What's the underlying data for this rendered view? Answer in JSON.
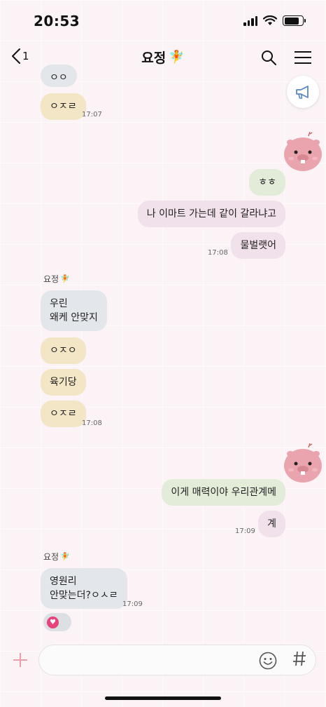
{
  "status_bar": {
    "time": "20:53"
  },
  "header": {
    "back_count": "1",
    "title": "요정",
    "title_emoji": "🧚"
  },
  "partial_message": {
    "text": "ㅇㅇ"
  },
  "messages": [
    {
      "text": "ㅇㅈㄹ",
      "time": "17:07"
    },
    {
      "text": "ㅎㅎ"
    },
    {
      "text": "나 이마트 가는데 같이 갈라냐고"
    },
    {
      "text": "물벌랫어",
      "time": "17:08"
    },
    {
      "sender": "요정",
      "lines": [
        "우린",
        "왜케 안맞지"
      ]
    },
    {
      "text": "ㅇㅈㅇ"
    },
    {
      "text": "육기당"
    },
    {
      "text": "ㅇㅈㄹ",
      "time": "17:08"
    },
    {
      "text": "이게 매력이야 우리관계메"
    },
    {
      "text": "계",
      "time": "17:09"
    },
    {
      "sender": "요정",
      "lines": [
        "영원리",
        "안맞는더?ㅇㅅㄹ"
      ],
      "time": "17:09"
    }
  ],
  "input": {
    "placeholder": ""
  },
  "colors": {
    "background": "#fbf3f5",
    "bubble_gray": "#e3e6ea",
    "bubble_cream": "#f2e6c6",
    "bubble_green": "#e2ecd9",
    "bubble_pink": "#f1e1ea",
    "notice_icon": "#5a86c8",
    "heart": "#e8427a"
  },
  "icons": [
    "back-chevron-icon",
    "search-icon",
    "menu-icon",
    "megaphone-icon",
    "plus-icon",
    "emoji-icon",
    "hash-icon",
    "heart-icon",
    "signal-icon",
    "wifi-icon",
    "battery-icon"
  ]
}
